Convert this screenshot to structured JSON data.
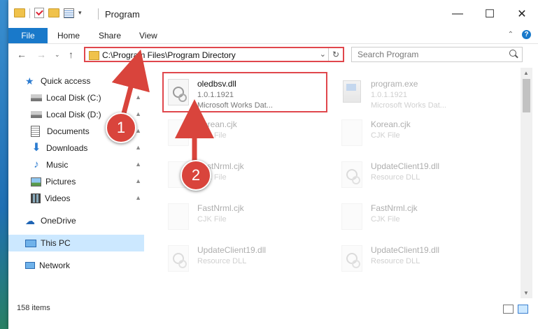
{
  "window": {
    "title": "Program"
  },
  "ribbon": {
    "tabs": [
      "File",
      "Home",
      "Share",
      "View"
    ]
  },
  "nav": {
    "address": "C:\\Program Files\\Program Directory",
    "search_placeholder": "Search Program"
  },
  "sidebar": {
    "items": [
      {
        "label": "Quick access",
        "icon": "star-icon",
        "pinned": false
      },
      {
        "label": "Local Disk (C:)",
        "icon": "drive-icon",
        "pinned": true
      },
      {
        "label": "Local Disk (D:)",
        "icon": "drive-icon",
        "pinned": true
      },
      {
        "label": "Documents",
        "icon": "documents-icon",
        "pinned": true
      },
      {
        "label": "Downloads",
        "icon": "download-icon",
        "pinned": true
      },
      {
        "label": "Music",
        "icon": "music-icon",
        "pinned": true
      },
      {
        "label": "Pictures",
        "icon": "pictures-icon",
        "pinned": true
      },
      {
        "label": "Videos",
        "icon": "videos-icon",
        "pinned": true
      },
      {
        "label": "OneDrive",
        "icon": "cloud-icon",
        "pinned": false
      },
      {
        "label": "This PC",
        "icon": "computer-icon",
        "pinned": false,
        "selected": true
      },
      {
        "label": "Network",
        "icon": "network-icon",
        "pinned": false
      }
    ]
  },
  "files": [
    {
      "name": "oledbsv.dll",
      "line2": "1.0.1.1921",
      "line3": "Microsoft Works Dat...",
      "type": "dll",
      "highlight": true
    },
    {
      "name": "program.exe",
      "line2": "1.0.1.1921",
      "line3": "Microsoft Works Dat...",
      "type": "exe"
    },
    {
      "name": "Korean.cjk",
      "line2": "CJK File",
      "line3": "",
      "type": "blank"
    },
    {
      "name": "Korean.cjk",
      "line2": "CJK File",
      "line3": "",
      "type": "blank"
    },
    {
      "name": "FastNrml.cjk",
      "line2": "CJK File",
      "line3": "",
      "type": "blank"
    },
    {
      "name": "UpdateClient19.dll",
      "line2": "Resource DLL",
      "line3": "",
      "type": "dll"
    },
    {
      "name": "FastNrml.cjk",
      "line2": "CJK File",
      "line3": "",
      "type": "blank"
    },
    {
      "name": "FastNrml.cjk",
      "line2": "CJK File",
      "line3": "",
      "type": "blank"
    },
    {
      "name": "UpdateClient19.dll",
      "line2": "Resource DLL",
      "line3": "",
      "type": "dll"
    },
    {
      "name": "UpdateClient19.dll",
      "line2": "Resource DLL",
      "line3": "",
      "type": "dll"
    }
  ],
  "status": {
    "count": "158 items"
  },
  "annotations": {
    "step1": "1",
    "step2": "2"
  },
  "colors": {
    "accent": "#1979ca",
    "highlight": "#e0474c",
    "callout": "#d9443c",
    "selected": "#cce8ff"
  }
}
